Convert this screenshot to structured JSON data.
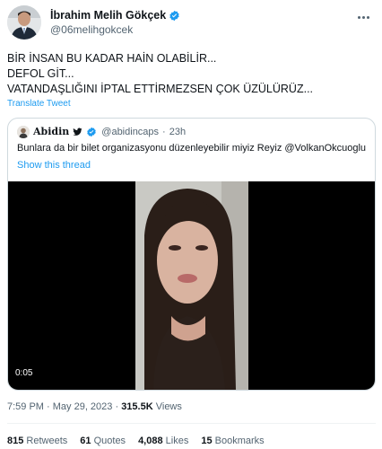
{
  "author": {
    "display_name": "İbrahim Melih Gökçek",
    "handle": "@06melihgokcek",
    "verified_icon": "verified-badge-icon"
  },
  "tweet": {
    "lines": [
      "BİR İNSAN BU KADAR HAİN OLABİLİR...",
      "DEFOL GİT...",
      "VATANDAŞLIĞINI İPTAL ETTİRMEZSEN ÇOK ÜZÜLÜRÜZ..."
    ],
    "translate_label": "Translate Tweet"
  },
  "quote": {
    "display_name": "Abidin",
    "handle": "@abidincaps",
    "separator": "·",
    "time": "23h",
    "text": "Bunlara da bir bilet organizasyonu düzenleyebilir miyiz Reyiz @VolkanOkcuoglu",
    "show_thread": "Show this thread",
    "video_duration": "0:05"
  },
  "meta": {
    "time": "7:59 PM",
    "separator": " · ",
    "date": "May 29, 2023",
    "views_count": "315.5K",
    "views_label": "Views"
  },
  "stats": {
    "retweets_count": "815",
    "retweets_label": "Retweets",
    "quotes_count": "61",
    "quotes_label": "Quotes",
    "likes_count": "4,088",
    "likes_label": "Likes",
    "bookmarks_count": "15",
    "bookmarks_label": "Bookmarks"
  },
  "colors": {
    "accent": "#1d9bf0",
    "text": "#0f1419",
    "muted": "#536471",
    "border": "#cfd9de"
  }
}
